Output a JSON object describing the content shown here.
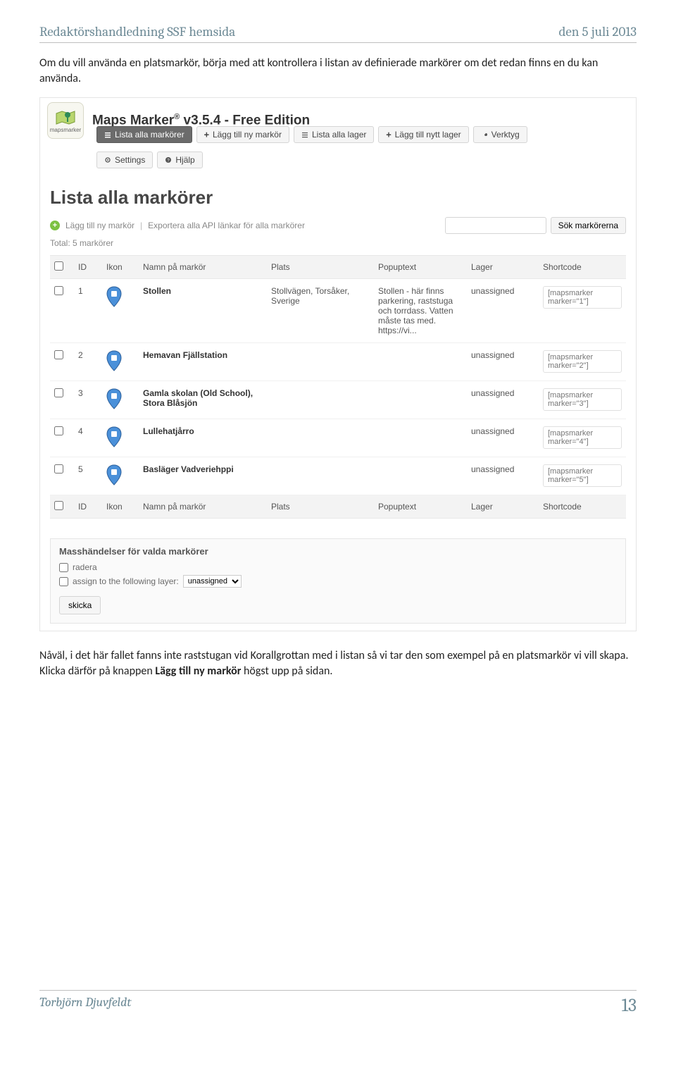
{
  "doc": {
    "header_left": "Redaktörshandledning SSF hemsida",
    "header_right": "den 5 juli 2013",
    "para1": "Om du vill använda en platsmarkör, börja med att kontrollera i listan av definierade markörer om det redan finns en du kan använda.",
    "para2_pre": "Nåväl, i det här fallet fanns inte raststugan vid Korallgrottan med i listan så vi tar den som exempel på en platsmarkör vi vill skapa. Klicka därför på knappen ",
    "para2_bold": "Lägg till ny markör",
    "para2_post": " högst upp på sidan.",
    "footer_author": "Torbjörn Djuvfeldt",
    "footer_page": "13"
  },
  "app": {
    "logo_label": "mapsmarker",
    "title_prefix": "Maps Marker",
    "title_reg": "®",
    "title_suffix": " v3.5.4 - Free Edition",
    "toolbar": {
      "list_markers": "Lista alla markörer",
      "add_marker": "Lägg till ny markör",
      "list_layers": "Lista alla lager",
      "add_layer": "Lägg till nytt lager",
      "tools": "Verktyg",
      "settings": "Settings",
      "help": "Hjälp"
    },
    "heading": "Lista alla markörer",
    "subbar": {
      "add_link": "Lägg till ny markör",
      "export_link": "Exportera alla API länkar för alla markörer",
      "search_btn": "Sök markörerna"
    },
    "total": "Total: 5 markörer",
    "columns": {
      "id": "ID",
      "ikon": "Ikon",
      "name": "Namn på markör",
      "plats": "Plats",
      "popup": "Popuptext",
      "lager": "Lager",
      "shortcode": "Shortcode"
    },
    "rows": [
      {
        "id": "1",
        "name": "Stollen",
        "plats": "Stollvägen, Torsåker, Sverige",
        "popup": "Stollen - här finns parkering, raststuga och torrdass. Vatten måste tas med. https://vi...",
        "lager": "unassigned",
        "shortcode": "[mapsmarker marker=\"1\"]"
      },
      {
        "id": "2",
        "name": "Hemavan Fjällstation",
        "plats": "",
        "popup": "",
        "lager": "unassigned",
        "shortcode": "[mapsmarker marker=\"2\"]"
      },
      {
        "id": "3",
        "name": "Gamla skolan (Old School), Stora Blåsjön",
        "plats": "",
        "popup": "",
        "lager": "unassigned",
        "shortcode": "[mapsmarker marker=\"3\"]"
      },
      {
        "id": "4",
        "name": "Lullehatjårro",
        "plats": "",
        "popup": "",
        "lager": "unassigned",
        "shortcode": "[mapsmarker marker=\"4\"]"
      },
      {
        "id": "5",
        "name": "Basläger Vadveriehppi",
        "plats": "",
        "popup": "",
        "lager": "unassigned",
        "shortcode": "[mapsmarker marker=\"5\"]"
      }
    ],
    "mass": {
      "title": "Masshändelser för valda markörer",
      "delete": "radera",
      "assign": "assign to the following layer:",
      "assign_value": "unassigned",
      "submit": "skicka"
    }
  }
}
